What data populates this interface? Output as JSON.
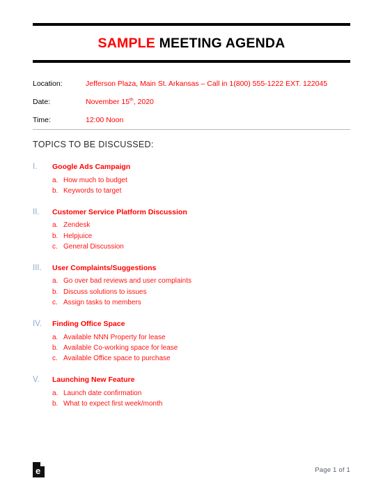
{
  "document": {
    "title_accent": "SAMPLE",
    "title_rest": " MEETING AGENDA",
    "colors": {
      "accent_red": "#ff0000",
      "numeral_blue": "#8fa8d4",
      "rule_black": "#000000",
      "rule_gray": "#b9b9b9",
      "page_number_gray": "#555f6e"
    }
  },
  "meta": {
    "rows": [
      {
        "label": "Location:",
        "value": "Jefferson Plaza, Main St. Arkansas – Call in 1(800) 555-1222 EXT. 122045"
      },
      {
        "label": "Date:",
        "value_main": "November 15",
        "value_sup": "th",
        "value_tail": ", 2020"
      },
      {
        "label": "Time:",
        "value": "12:00 Noon"
      }
    ]
  },
  "topics": {
    "heading": "TOPICS TO BE DISCUSSED:",
    "sections": [
      {
        "numeral": "I.",
        "title": "Google Ads Campaign",
        "items": [
          {
            "marker": "a.",
            "text": "How much to budget"
          },
          {
            "marker": "b.",
            "text": "Keywords to target"
          }
        ]
      },
      {
        "numeral": "II.",
        "title": "Customer Service Platform Discussion",
        "items": [
          {
            "marker": "a.",
            "text": "Zendesk"
          },
          {
            "marker": "b.",
            "text": "Helpjuice"
          },
          {
            "marker": "c.",
            "text": "General Discussion"
          }
        ]
      },
      {
        "numeral": "III.",
        "title": "User Complaints/Suggestions",
        "items": [
          {
            "marker": "a.",
            "text": "Go over bad reviews and user complaints"
          },
          {
            "marker": "b.",
            "text": "Discuss solutions to issues"
          },
          {
            "marker": "c.",
            "text": "Assign tasks to members"
          }
        ]
      },
      {
        "numeral": "IV.",
        "title": "Finding Office Space",
        "items": [
          {
            "marker": "a.",
            "text": "Available NNN Property for lease"
          },
          {
            "marker": "b.",
            "text": "Available Co-working space for lease"
          },
          {
            "marker": "c.",
            "text": "Available Office space to purchase"
          }
        ]
      },
      {
        "numeral": "V.",
        "title": "Launching New Feature",
        "items": [
          {
            "marker": "a.",
            "text": "Launch date confirmation"
          },
          {
            "marker": "b.",
            "text": "What to expect first week/month"
          }
        ]
      }
    ]
  },
  "footer": {
    "logo_icon": "document-e-icon",
    "logo_letter": "e",
    "page_number": "Page 1 of 1"
  }
}
